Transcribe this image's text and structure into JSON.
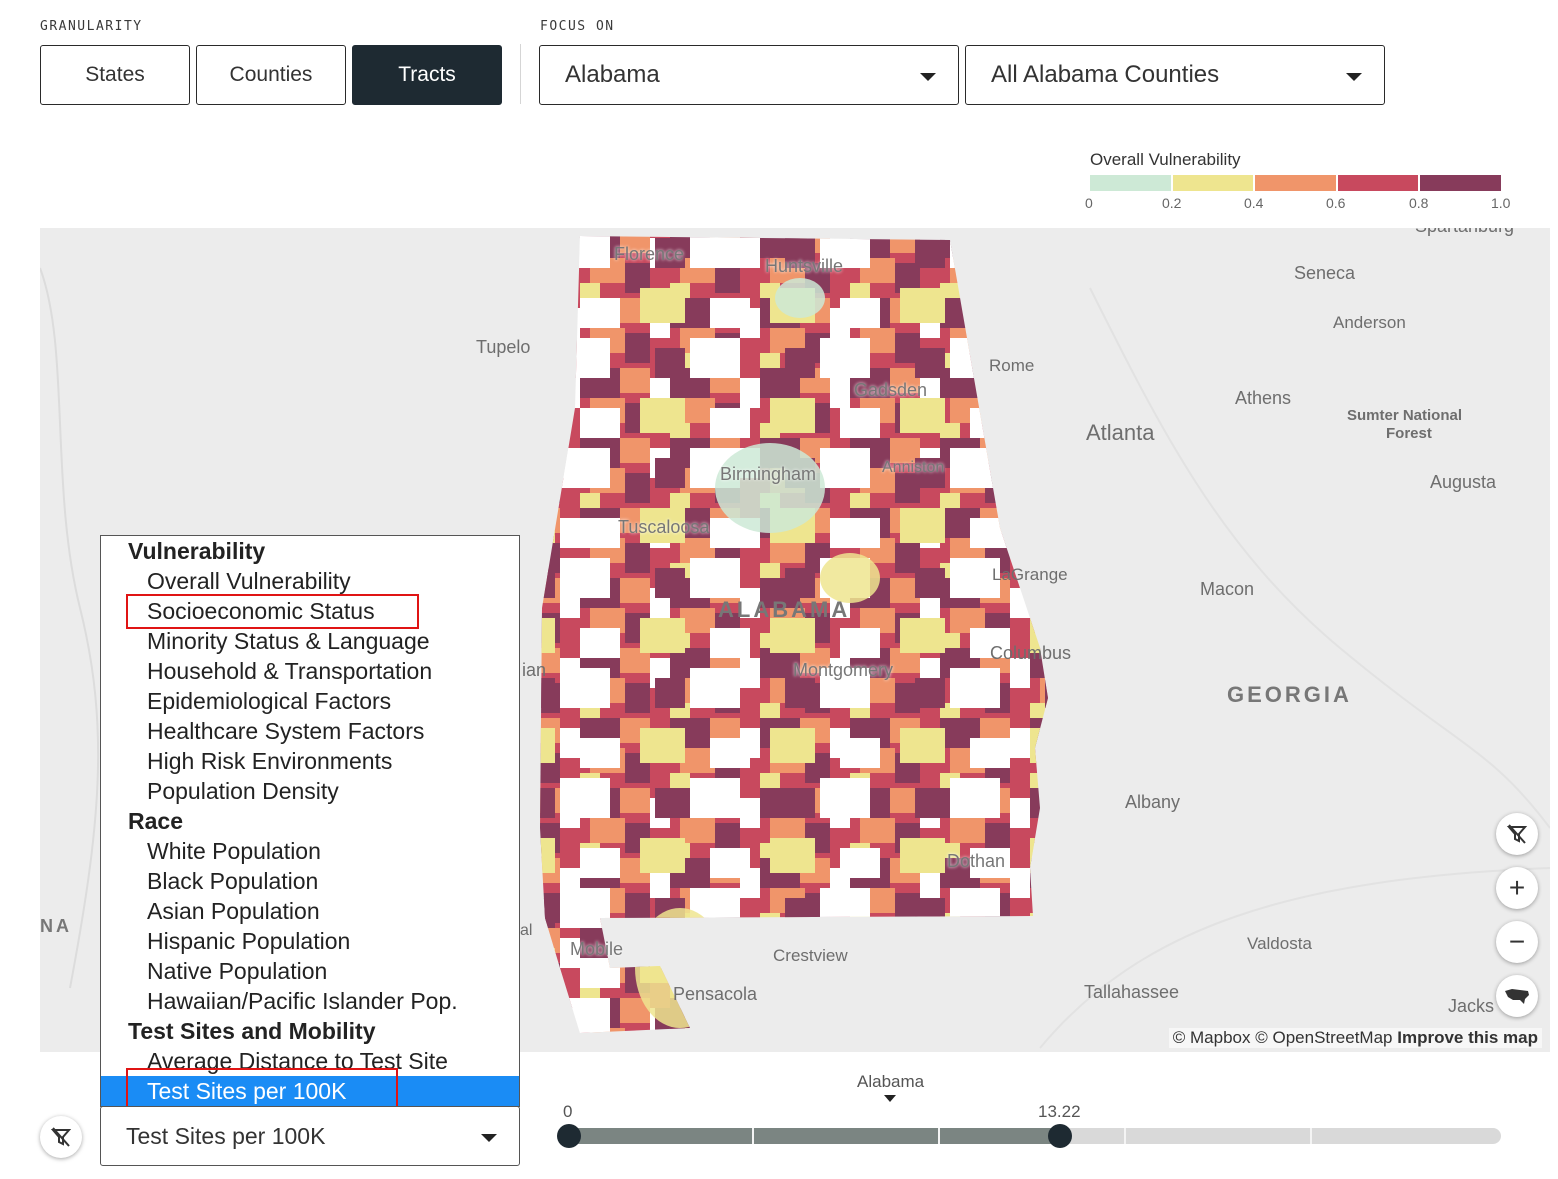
{
  "granularity": {
    "label": "GRANULARITY",
    "buttons": [
      "States",
      "Counties",
      "Tracts"
    ],
    "active": "Tracts"
  },
  "focus": {
    "label": "FOCUS ON",
    "state_value": "Alabama",
    "county_value": "All Alabama Counties"
  },
  "legend": {
    "title": "Overall Vulnerability",
    "colors": [
      "#cde9d6",
      "#eee58f",
      "#f0956a",
      "#c8495e",
      "#873b5b"
    ],
    "ticks": [
      "0",
      "0.2",
      "0.4",
      "0.6",
      "0.8",
      "1.0"
    ]
  },
  "map": {
    "state_label": "ALABAMA",
    "georgia_label": "GEORGIA",
    "cities_in_state": [
      "Florence",
      "Huntsville",
      "Gadsden",
      "Birmingham",
      "Anniston",
      "Tuscaloosa",
      "Montgomery",
      "Mobile",
      "Dothan"
    ],
    "cities_outside": [
      "Tupelo",
      "Rome",
      "Seneca",
      "Anderson",
      "Athens",
      "Atlanta",
      "Sumter National",
      "Forest",
      "Augusta",
      "LaGrange",
      "Columbus",
      "Macon",
      "Albany",
      "Crestview",
      "Pensacola",
      "Tallahassee",
      "Valdosta",
      "Spartanburg",
      "Jacks",
      "ian",
      "al",
      "NA"
    ],
    "attribution_1": "© Mapbox",
    "attribution_2": "© OpenStreetMap",
    "attribution_3": "Improve this map",
    "controls": {
      "filter_icon": "no-filter-icon",
      "zoom_in": "+",
      "zoom_out": "−",
      "reset_icon": "usa-map-icon"
    }
  },
  "metric_menu": {
    "groups": [
      {
        "title": "Vulnerability",
        "items": [
          "Overall Vulnerability",
          "Socioeconomic Status",
          "Minority Status & Language",
          "Household & Transportation",
          "Epidemiological Factors",
          "Healthcare System Factors",
          "High Risk Environments",
          "Population Density"
        ]
      },
      {
        "title": "Race",
        "items": [
          "White Population",
          "Black Population",
          "Asian Population",
          "Hispanic Population",
          "Native Population",
          "Hawaiian/Pacific Islander Pop."
        ]
      },
      {
        "title": "Test Sites and Mobility",
        "items": [
          "Average Distance to Test Site",
          "Test Sites per 100K"
        ]
      }
    ],
    "highlighted_item": "Test Sites per 100K",
    "selected_value": "Test Sites per 100K"
  },
  "slider": {
    "marker_label": "Alabama",
    "min_label": "0",
    "value_label": "13.22",
    "value_fraction": 0.527
  }
}
